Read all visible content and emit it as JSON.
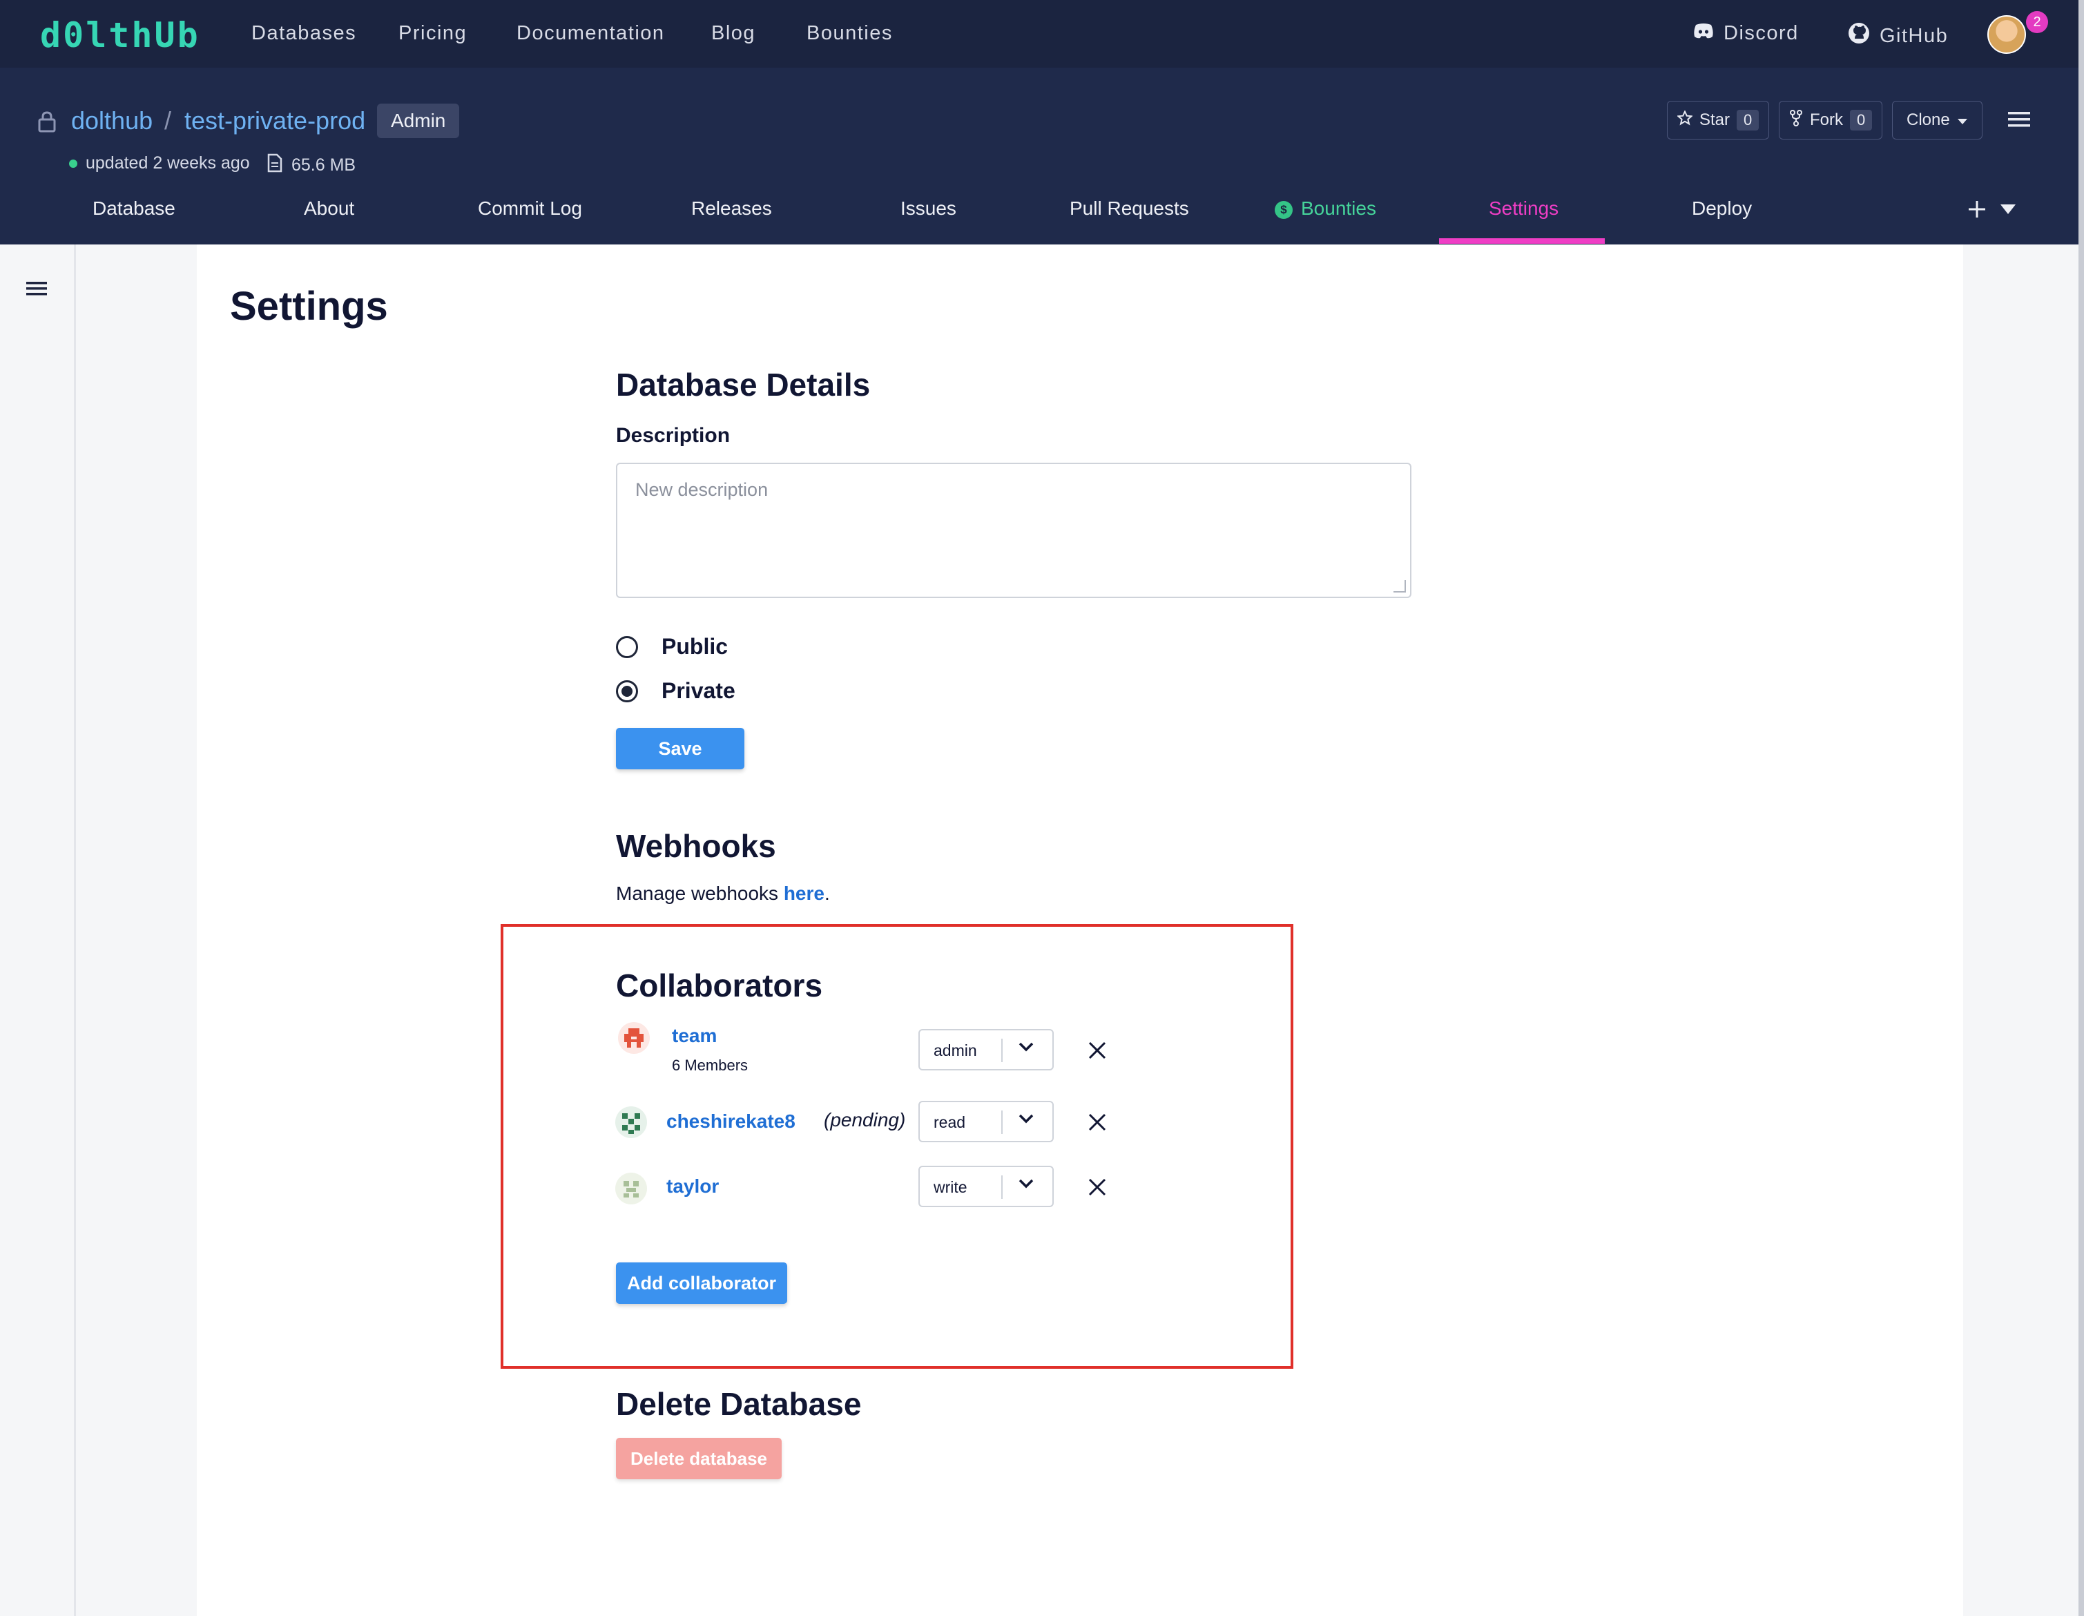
{
  "topnav": {
    "logo": "d0lthUb",
    "links": [
      "Databases",
      "Pricing",
      "Documentation",
      "Blog",
      "Bounties"
    ],
    "discord": "Discord",
    "github": "GitHub",
    "notification_count": "2"
  },
  "repo": {
    "owner": "dolthub",
    "separator": "/",
    "name": "test-private-prod",
    "role_badge": "Admin",
    "updated": "updated 2 weeks ago",
    "size": "65.6 MB",
    "star_label": "Star",
    "star_count": "0",
    "fork_label": "Fork",
    "fork_count": "0",
    "clone_label": "Clone"
  },
  "tabs": [
    "Database",
    "About",
    "Commit Log",
    "Releases",
    "Issues",
    "Pull Requests",
    "Bounties",
    "Settings",
    "Deploy"
  ],
  "active_tab": "Settings",
  "settings": {
    "title": "Settings",
    "details_heading": "Database Details",
    "description_label": "Description",
    "description_placeholder": "New description",
    "visibility_options": [
      "Public",
      "Private"
    ],
    "visibility_selected": "Private",
    "save_label": "Save",
    "webhooks_heading": "Webhooks",
    "webhooks_text": "Manage webhooks ",
    "webhooks_link": "here",
    "webhooks_end": ".",
    "collaborators_heading": "Collaborators",
    "collaborators": [
      {
        "name": "team",
        "sub": "6 Members",
        "status": "",
        "permission": "admin"
      },
      {
        "name": "cheshirekate8",
        "sub": "",
        "status": "(pending)",
        "permission": "read"
      },
      {
        "name": "taylor",
        "sub": "",
        "status": "",
        "permission": "write"
      }
    ],
    "add_collaborator_label": "Add collaborator",
    "delete_heading": "Delete Database",
    "delete_label": "Delete database"
  },
  "colors": {
    "nav_bg": "#1b2440",
    "header_bg": "#1f2a4b",
    "accent_pink": "#ef3ec5",
    "link_blue": "#1f6ed4",
    "button_blue": "#3b92ef",
    "danger": "#f5a3a0",
    "highlight_box": "#e0302a"
  }
}
